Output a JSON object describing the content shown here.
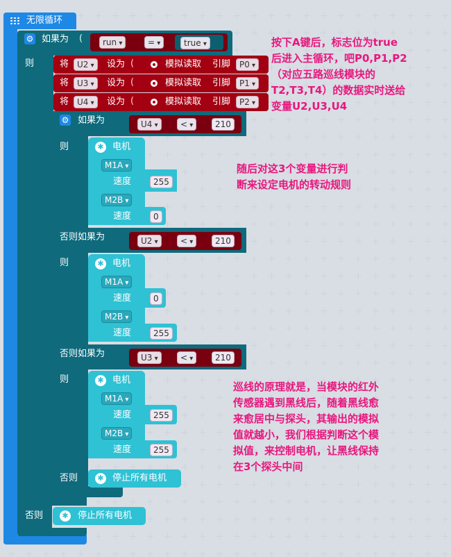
{
  "loop": {
    "title": "无限循环"
  },
  "if_main": {
    "if_label": "如果为",
    "then_label": "则",
    "else_label": "否则"
  },
  "cond_main": {
    "var": "run",
    "op": "=",
    "value": "true"
  },
  "assigns": [
    {
      "prefix": "将",
      "var": "U2",
      "set": "设为",
      "read": "模拟读取",
      "pin_label": "引脚",
      "pin": "P0"
    },
    {
      "prefix": "将",
      "var": "U3",
      "set": "设为",
      "read": "模拟读取",
      "pin_label": "引脚",
      "pin": "P1"
    },
    {
      "prefix": "将",
      "var": "U4",
      "set": "设为",
      "read": "模拟读取",
      "pin_label": "引脚",
      "pin": "P2"
    }
  ],
  "if_inner": {
    "if_label": "如果为",
    "elseif_label": "否则如果为",
    "then_label": "则",
    "else_label": "否则"
  },
  "conds": [
    {
      "var": "U4",
      "op": "<",
      "value": "210"
    },
    {
      "var": "U2",
      "op": "<",
      "value": "210"
    },
    {
      "var": "U3",
      "op": "<",
      "value": "210"
    }
  ],
  "motor_blocks": [
    {
      "title": "电机",
      "m1": "M1A",
      "speed_label": "速度",
      "s1": "255",
      "m2": "M2B",
      "s2": "0"
    },
    {
      "title": "电机",
      "m1": "M1A",
      "speed_label": "速度",
      "s1": "0",
      "m2": "M2B",
      "s2": "255"
    },
    {
      "title": "电机",
      "m1": "M1A",
      "speed_label": "速度",
      "s1": "255",
      "m2": "M2B",
      "s2": "255"
    }
  ],
  "stop_all": "停止所有电机",
  "annotations": {
    "a1": [
      "按下A键后，标志位为true",
      "后进入主循环，吧P0,P1,P2",
      "（对应五路巡线模块的",
      "T2,T3,T4）的数据实时送给",
      "变量U2,U3,U4"
    ],
    "a2": [
      "随后对这3个变量进行判",
      "断来设定电机的转动规则"
    ],
    "a3": [
      "巡线的原理就是，当模块的红外",
      "传感器遇到黑线后，随着黑线愈",
      "来愈居中与探头，其输出的模拟",
      "值就越小，我们根据判断这个模",
      "拟值，来控制电机，让黑线保持",
      "在3个探头中间"
    ]
  }
}
